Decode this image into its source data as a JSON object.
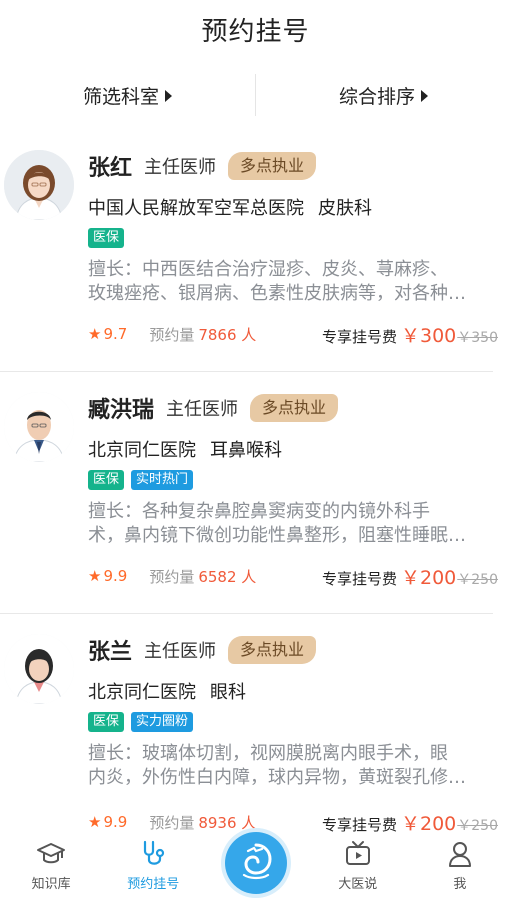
{
  "header": {
    "title": "预约挂号"
  },
  "filters": {
    "department_label": "筛选科室",
    "sort_label": "综合排序"
  },
  "doctors": [
    {
      "name": "张红",
      "title": "主任医师",
      "multi_practice": "多点执业",
      "hospital": "中国人民解放军空军总医院",
      "department": "皮肤科",
      "tags": [
        "医保"
      ],
      "specialty_line1": "擅长：中西医结合治疗湿疹、皮炎、荨麻疹、",
      "specialty_line2": "玫瑰痤疮、银屑病、色素性皮肤病等，对各种…",
      "star": "★",
      "rating": "9.7",
      "booking_label": "预约量",
      "booking_count": "7866 人",
      "fee_label": "专享挂号费",
      "price": "￥300",
      "old_price": "￥350",
      "avatar_icon": "female-doctor-avatar"
    },
    {
      "name": "臧洪瑞",
      "title": "主任医师",
      "multi_practice": "多点执业",
      "hospital": "北京同仁医院",
      "department": "耳鼻喉科",
      "tags": [
        "医保",
        "实时热门"
      ],
      "specialty_line1": "擅长：各种复杂鼻腔鼻窦病变的内镜外科手",
      "specialty_line2": "术，鼻内镜下微创功能性鼻整形，阻塞性睡眠…",
      "star": "★",
      "rating": "9.9",
      "booking_label": "预约量",
      "booking_count": "6582 人",
      "fee_label": "专享挂号费",
      "price": "￥200",
      "old_price": "￥250",
      "avatar_icon": "male-doctor-avatar"
    },
    {
      "name": "张兰",
      "title": "主任医师",
      "multi_practice": "多点执业",
      "hospital": "北京同仁医院",
      "department": "眼科",
      "tags": [
        "医保",
        "实力圈粉"
      ],
      "specialty_line1": "擅长：玻璃体切割，视网膜脱离内眼手术，眼",
      "specialty_line2": "内炎，外伤性白内障，球内异物，黄斑裂孔修…",
      "star": "★",
      "rating": "9.9",
      "booking_label": "预约量",
      "booking_count": "8936 人",
      "fee_label": "专享挂号费",
      "price": "￥200",
      "old_price": "￥250",
      "avatar_icon": "female-doctor-avatar"
    }
  ],
  "tabbar": {
    "items": [
      {
        "label": "知识库",
        "icon": "graduation-cap-icon"
      },
      {
        "label": "预约挂号",
        "icon": "stethoscope-icon",
        "active": true
      },
      {
        "label": "",
        "icon": "center-logo-icon"
      },
      {
        "label": "大医说",
        "icon": "tv-play-icon"
      },
      {
        "label": "我",
        "icon": "user-icon"
      }
    ]
  },
  "colors": {
    "accent_blue": "#1e9be0",
    "price_red": "#f05a3a",
    "rating_orange": "#ff6a2a",
    "tag_green": "#15b38c",
    "multi_practice_bg": "#e7c9a4"
  }
}
